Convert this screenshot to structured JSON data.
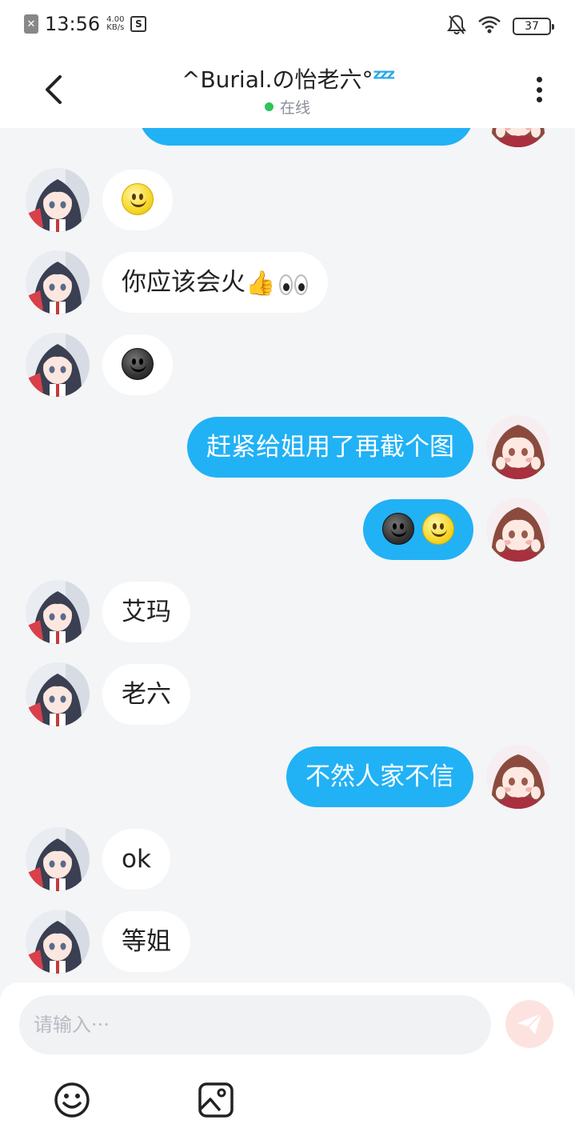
{
  "status_bar": {
    "time": "13:56",
    "speed_value": "4.00",
    "speed_unit": "KB/s",
    "battery": "37"
  },
  "header": {
    "title": "^Burial.の怡老六°",
    "title_badge": "zzz",
    "status": "在线",
    "status_color": "#2ec45a"
  },
  "messages": [
    {
      "side": "out",
      "text": "",
      "partial": true
    },
    {
      "side": "in",
      "text": "",
      "emojis": [
        "slightly-smiling-face"
      ]
    },
    {
      "side": "in",
      "text": "你应该会火",
      "emojis": [
        "thumbs-up",
        "eyes"
      ]
    },
    {
      "side": "in",
      "text": "",
      "emojis": [
        "dark-smiling-face"
      ]
    },
    {
      "side": "out",
      "text": "赶紧给姐用了再截个图"
    },
    {
      "side": "out",
      "text": "",
      "emojis": [
        "dark-smiling-face",
        "slightly-smiling-face"
      ]
    },
    {
      "side": "in",
      "text": "艾玛"
    },
    {
      "side": "in",
      "text": "老六"
    },
    {
      "side": "out",
      "text": "不然人家不信"
    },
    {
      "side": "in",
      "text": "ok"
    },
    {
      "side": "in",
      "text": "等姐"
    }
  ],
  "input": {
    "placeholder": "请输入···"
  },
  "colors": {
    "outgoing_bubble": "#21b1f5",
    "incoming_bubble": "#ffffff",
    "background": "#f4f5f7",
    "send_button": "#fde3e0"
  },
  "icons": {
    "back": "back-arrow-icon",
    "menu": "more-vertical-icon",
    "send": "send-icon",
    "emoji": "emoji-icon",
    "image": "image-icon"
  }
}
